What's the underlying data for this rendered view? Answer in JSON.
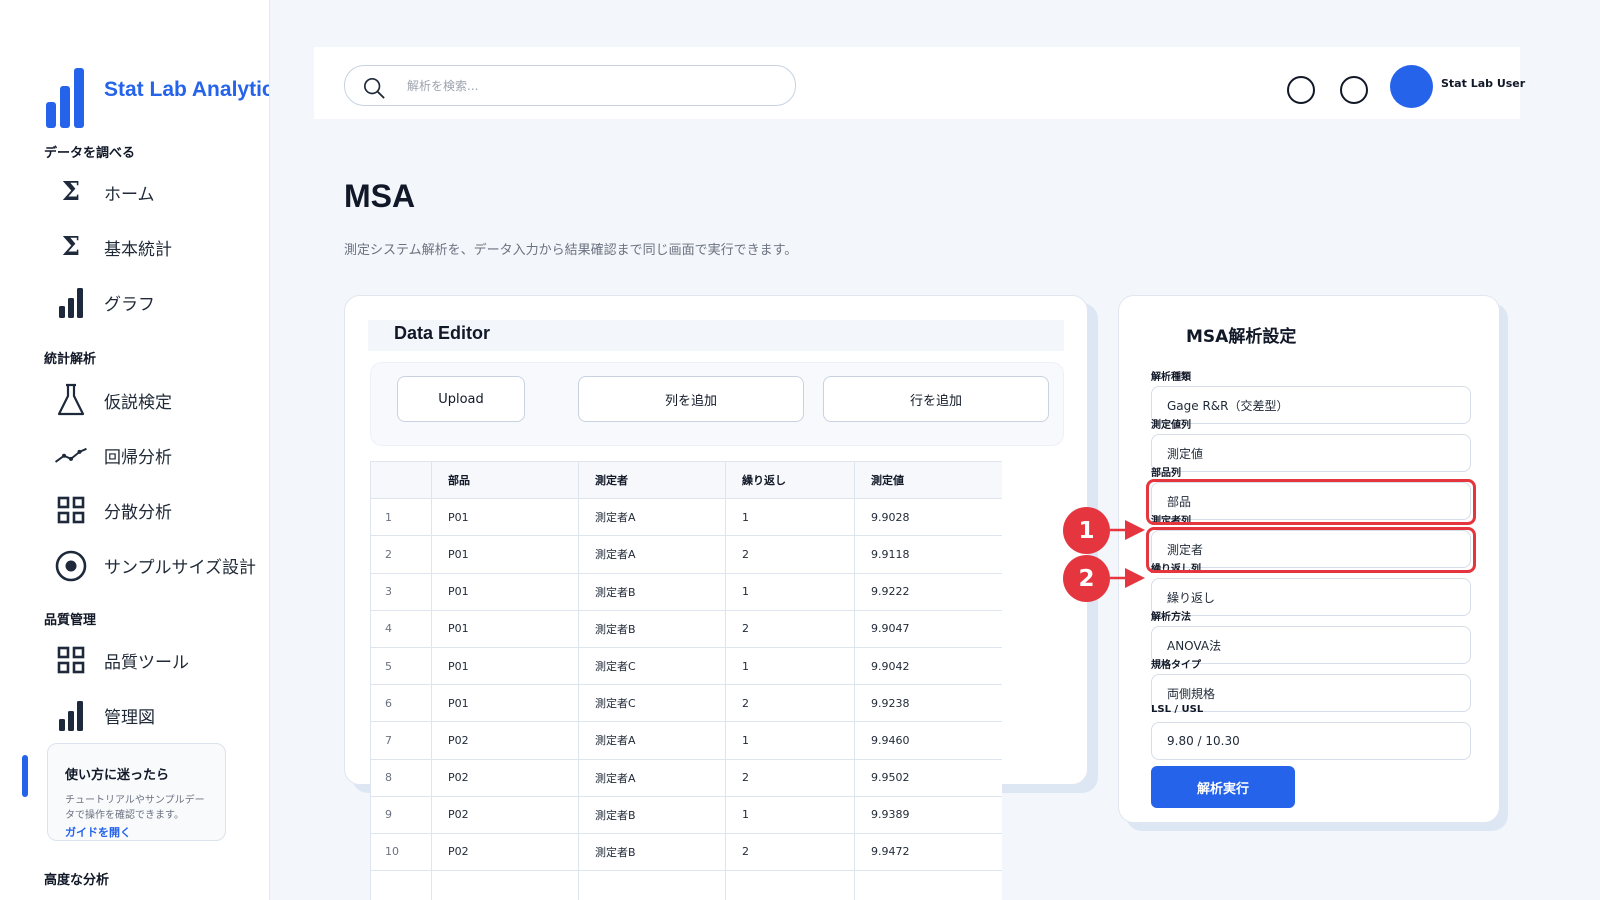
{
  "app": {
    "name": "Stat Lab Analytics"
  },
  "sidebar": {
    "sections": {
      "explore": "データを調べる",
      "stats": "統計解析",
      "quality": "品質管理",
      "advanced": "高度な分析"
    },
    "items": {
      "home": "ホーム",
      "basic_stats": "基本統計",
      "graph": "グラフ",
      "hypothesis": "仮説検定",
      "regression": "回帰分析",
      "anova": "分散分析",
      "sample_size": "サンプルサイズ設計",
      "quality_tools": "品質ツール",
      "control_chart": "管理図"
    },
    "help": {
      "title": "使い方に迷ったら",
      "desc": "チュートリアルやサンプルデータで操作を確認できます。",
      "link": "ガイドを開く"
    }
  },
  "header": {
    "search_placeholder": "解析を検索...",
    "user_name": "Stat Lab User"
  },
  "page": {
    "title": "MSA",
    "subtitle": "測定システム解析を、データ入力から結果確認まで同じ画面で実行できます。"
  },
  "editor": {
    "title": "Data Editor",
    "buttons": {
      "upload": "Upload",
      "add_column": "列を追加",
      "add_row": "行を追加"
    },
    "columns": [
      "",
      "部品",
      "測定者",
      "繰り返し",
      "測定値"
    ],
    "rows": [
      [
        "1",
        "P01",
        "測定者A",
        "1",
        "9.9028"
      ],
      [
        "2",
        "P01",
        "測定者A",
        "2",
        "9.9118"
      ],
      [
        "3",
        "P01",
        "測定者B",
        "1",
        "9.9222"
      ],
      [
        "4",
        "P01",
        "測定者B",
        "2",
        "9.9047"
      ],
      [
        "5",
        "P01",
        "測定者C",
        "1",
        "9.9042"
      ],
      [
        "6",
        "P01",
        "測定者C",
        "2",
        "9.9238"
      ],
      [
        "7",
        "P02",
        "測定者A",
        "1",
        "9.9460"
      ],
      [
        "8",
        "P02",
        "測定者A",
        "2",
        "9.9502"
      ],
      [
        "9",
        "P02",
        "測定者B",
        "1",
        "9.9389"
      ],
      [
        "10",
        "P02",
        "測定者B",
        "2",
        "9.9472"
      ],
      [
        "",
        "",
        "",
        "",
        ""
      ]
    ]
  },
  "settings": {
    "title": "MSA解析設定",
    "fields": [
      {
        "label": "解析種類",
        "value": "Gage R&R（交差型）"
      },
      {
        "label": "測定値列",
        "value": "測定値"
      },
      {
        "label": "部品列",
        "value": "部品"
      },
      {
        "label": "測定者列",
        "value": "測定者"
      },
      {
        "label": "繰り返し列",
        "value": "繰り返し"
      },
      {
        "label": "解析方法",
        "value": "ANOVA法"
      },
      {
        "label": "規格タイプ",
        "value": "両側規格"
      },
      {
        "label": "LSL / USL",
        "value": "9.80 / 10.30"
      }
    ],
    "run_label": "解析実行"
  },
  "annotations": {
    "badge1": "1",
    "badge2": "2",
    "color": "#e5363f"
  },
  "colors": {
    "accent": "#2563eb",
    "highlight": "#e5363f"
  },
  "icons": {
    "home": "sigma-icon",
    "basic_stats": "sigma-icon",
    "graph": "bar-chart-icon",
    "hypothesis": "flask-icon",
    "regression": "trend-line-icon",
    "anova": "grid-icon",
    "sample_size": "target-icon",
    "quality_tools": "grid-icon",
    "control_chart": "bar-chart-icon"
  }
}
